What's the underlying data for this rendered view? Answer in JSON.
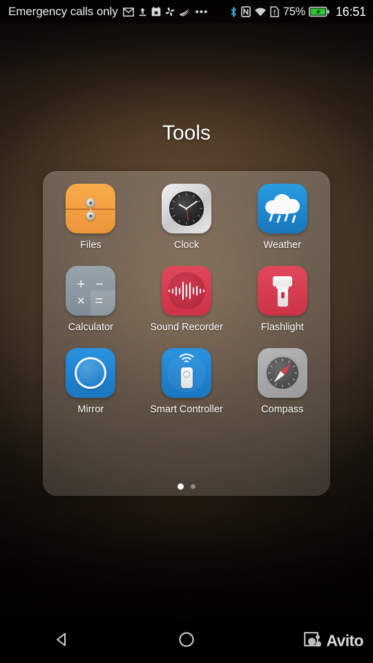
{
  "status_bar": {
    "carrier": "Emergency calls only",
    "left_icons": [
      "gmail-icon",
      "upload-icon",
      "calendar-icon",
      "pinwheel-icon",
      "swoosh-icon"
    ],
    "overflow": "•••",
    "right_icons": [
      "bluetooth-icon",
      "nfc-icon",
      "wifi-icon",
      "sim-alert-icon"
    ],
    "battery_percent": "75%",
    "battery_state": "charging",
    "clock": "16:51"
  },
  "folder": {
    "title": "Tools",
    "apps": [
      {
        "label": "Files",
        "icon": "files-icon",
        "color": "#f2a142"
      },
      {
        "label": "Clock",
        "icon": "clock-icon",
        "color": "#d9d9d9"
      },
      {
        "label": "Weather",
        "icon": "weather-icon",
        "color": "#1e86cc"
      },
      {
        "label": "Calculator",
        "icon": "calculator-icon",
        "color": "#8c98a1"
      },
      {
        "label": "Sound Recorder",
        "icon": "sound-recorder-icon",
        "color": "#d63b50"
      },
      {
        "label": "Flashlight",
        "icon": "flashlight-icon",
        "color": "#d63b50"
      },
      {
        "label": "Mirror",
        "icon": "mirror-icon",
        "color": "#1f82cf"
      },
      {
        "label": "Smart Controller",
        "icon": "smart-controller-icon",
        "color": "#1f82cf"
      },
      {
        "label": "Compass",
        "icon": "compass-icon",
        "color": "#a8a8a8"
      }
    ],
    "calculator_glyphs": {
      "plus": "+",
      "minus": "−",
      "times": "×",
      "equals": "="
    },
    "page_count": 2,
    "active_page": 1
  },
  "nav_bar": {
    "back": "back-icon",
    "home": "home-icon",
    "recents": "recents-icon",
    "watermark": "Avito"
  }
}
